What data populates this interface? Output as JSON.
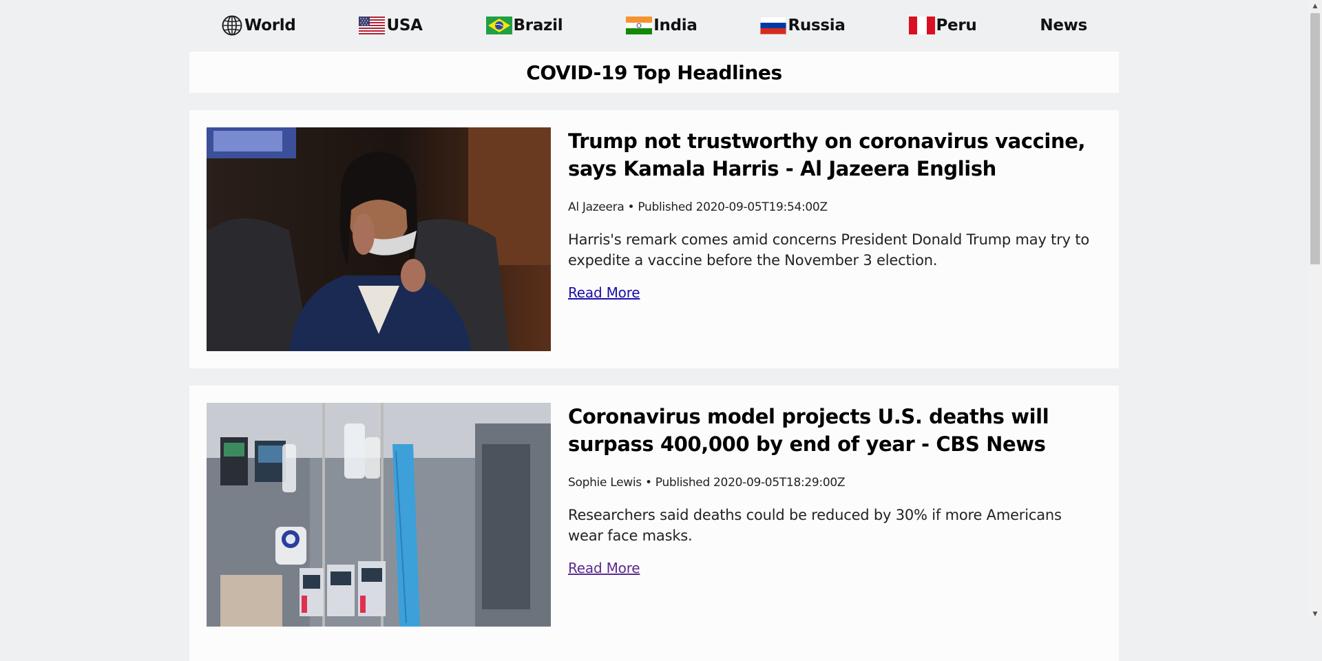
{
  "nav": {
    "items": [
      {
        "label": "World",
        "icon": "globe-icon"
      },
      {
        "label": "USA",
        "icon": "usa-flag-icon"
      },
      {
        "label": "Brazil",
        "icon": "brazil-flag-icon"
      },
      {
        "label": "India",
        "icon": "india-flag-icon"
      },
      {
        "label": "Russia",
        "icon": "russia-flag-icon"
      },
      {
        "label": "Peru",
        "icon": "peru-flag-icon"
      },
      {
        "label": "News",
        "icon": ""
      }
    ]
  },
  "header": {
    "title": "COVID-19 Top Headlines"
  },
  "articles": [
    {
      "title": "Trump not trustworthy on coronavirus vaccine, says Kamala Harris - Al Jazeera English",
      "meta": "Al Jazeera • Published 2020-09-05T19:54:00Z",
      "description": "Harris's remark comes amid concerns President Donald Trump may try to expedite a vaccine before the November 3 election.",
      "link_label": "Read More"
    },
    {
      "title": "Coronavirus model projects U.S. deaths will surpass 400,000 by end of year - CBS News",
      "meta": "Sophie Lewis • Published 2020-09-05T18:29:00Z",
      "description": "Researchers said deaths could be reduced by 30% if more Americans wear face masks.",
      "link_label": "Read More"
    }
  ],
  "colors": {
    "page_background": "#eef0f2",
    "card_background": "#fcfcfc",
    "link": "#1a0dab",
    "link_visited": "#5a2b8c"
  }
}
